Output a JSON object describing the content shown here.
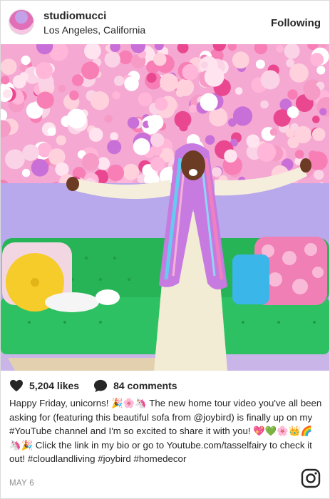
{
  "header": {
    "username": "studiomucci",
    "location": "Los Angeles, California",
    "follow_label": "Following"
  },
  "photo": {
    "wall_color": "#f2a3cf",
    "sofa_color": "#2bb85a",
    "floor_color": "#b8a9ea"
  },
  "actions": {
    "likes": "5,204 likes",
    "comments": "84 comments"
  },
  "caption": {
    "text": "Happy Friday, unicorns! 🎉🌸🦄 The new home tour video you've all been asking for (featuring this beautiful sofa from @joybird) is finally up on my #YouTube channel and I'm so excited to share it with you! 💖💚🌸👑🌈🦄🎉 Click the link in my bio or go to Youtube.com/tasselfairy to check it out! #cloudlandliving #joybird #homedecor"
  },
  "date": "MAY 6",
  "icons": {
    "like": "heart-icon",
    "comment": "speech-bubble-icon",
    "brand": "instagram-icon"
  }
}
